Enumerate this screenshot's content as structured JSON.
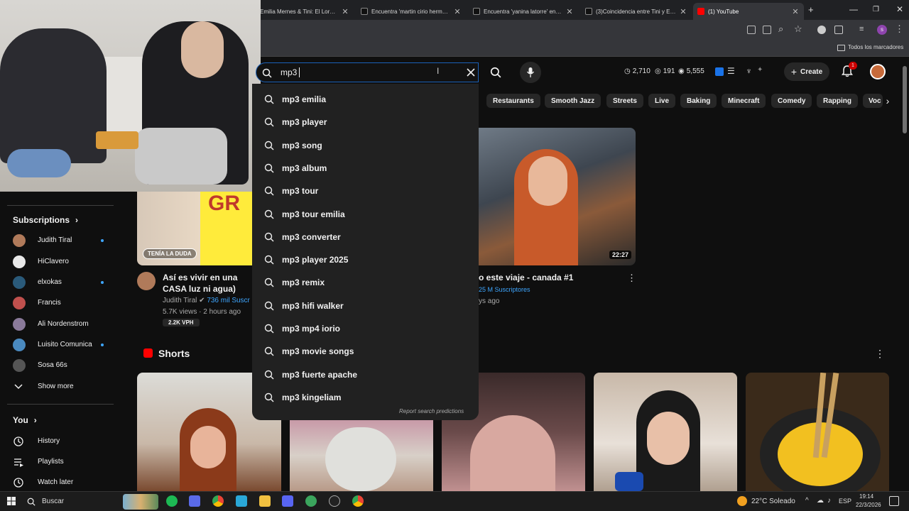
{
  "browser": {
    "tabs": [
      {
        "title": "Emilia Mernes & Tini: El Lore D..."
      },
      {
        "title": "Encuentra 'martin cirio herman..."
      },
      {
        "title": "Encuentra 'yanina latorre' en Ti..."
      },
      {
        "title": "(3)Coincidencia entre Tini y Em..."
      },
      {
        "title": "(1) YouTube"
      }
    ],
    "new_tab": "+",
    "bookmarks_label": "Todos los marcadores"
  },
  "search": {
    "query": "mp3",
    "suggestions": [
      "mp3 emilia",
      "mp3 player",
      "mp3 song",
      "mp3 album",
      "mp3 tour",
      "mp3 tour emilia",
      "mp3 converter",
      "mp3 player 2025",
      "mp3 remix",
      "mp3 hifi walker",
      "mp3 mp4 iorio",
      "mp3 movie songs",
      "mp3 fuerte apache",
      "mp3 kingeliam"
    ],
    "report": "Report search predictions"
  },
  "header_stats": {
    "s1": "2,710",
    "s2": "191",
    "s3": "5,555"
  },
  "header": {
    "create": "Create",
    "notif_count": "1"
  },
  "chips": [
    "Restaurants",
    "Smooth Jazz",
    "Streets",
    "Live",
    "Baking",
    "Minecraft",
    "Comedy",
    "Rapping",
    "Voc"
  ],
  "sidebar": {
    "subscriptions_title": "Subscriptions",
    "subs": [
      {
        "name": "Judith Tiral",
        "dot": true,
        "color": "#b07a5a"
      },
      {
        "name": "HiClavero",
        "dot": false,
        "color": "#e8e8e8"
      },
      {
        "name": "elxokas",
        "dot": true,
        "color": "#2a5a7a"
      },
      {
        "name": "Francis",
        "dot": false,
        "color": "#c0504d"
      },
      {
        "name": "Ali Nordenstrom",
        "dot": false,
        "color": "#8a7a9a"
      },
      {
        "name": "Luisito Comunica",
        "dot": true,
        "color": "#4a8ac0"
      },
      {
        "name": "Sosa 66s",
        "dot": false,
        "color": "#555555"
      }
    ],
    "show_more": "Show more",
    "you_title": "You",
    "you_items": [
      "History",
      "Playlists",
      "Watch later"
    ]
  },
  "videos": [
    {
      "title": "Así es vivir en una CASA luz ni agua)",
      "channel": "Judith Tiral",
      "subs": "736 mil Suscr",
      "meta": "5.7K views · 2 hours ago",
      "vph": "2.2K VPH",
      "overlay": "TENÍA LA DUDA",
      "badge": "GR"
    },
    {
      "title": "o este viaje - canada #1",
      "subs": "25 M Suscriptores",
      "meta": "ys ago",
      "duration": "22:27"
    }
  ],
  "shorts": {
    "title": "Shorts"
  },
  "taskbar": {
    "search": "Buscar",
    "weather": "22°C Soleado",
    "lang": "ESP",
    "time": "19:14",
    "date": "22/3/2026"
  }
}
